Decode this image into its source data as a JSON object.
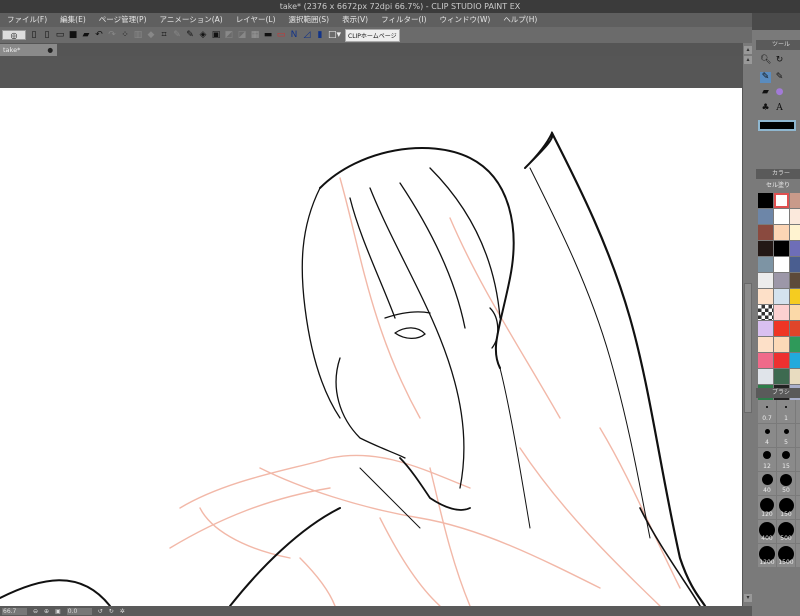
{
  "window": {
    "title": "take* (2376 x 6672px 72dpi 66.7%) - CLIP STUDIO PAINT EX"
  },
  "menu": [
    "ファイル(F)",
    "編集(E)",
    "ページ管理(P)",
    "アニメーション(A)",
    "レイヤー(L)",
    "選択範囲(S)",
    "表示(V)",
    "フィルター(I)",
    "ウィンドウ(W)",
    "ヘルプ(H)"
  ],
  "toolbar": {
    "home_label": "CLIPホームページ"
  },
  "tab": {
    "label": "take*",
    "close": "●"
  },
  "status": {
    "zoom": "66.7",
    "angle": "0.0"
  },
  "panels": {
    "tool_title": "ツール",
    "color_title": "カラー",
    "color_set": "セル塗り",
    "brush_title": "ブラシ"
  },
  "colors": [
    "#000000",
    "#f9e0d6",
    "#c99a8a",
    "#6d86a8",
    "#ffffff",
    "#fbe9dc",
    "#8a4a3f",
    "#fcd5b5",
    "#fff3d0",
    "#231815",
    "#000000",
    "#6e6eb8",
    "#7d94a4",
    "#ffffff",
    "#4a5e90",
    "#ececec",
    "#9c97a8",
    "#5d4a3a",
    "#fde0c8",
    "#d4e2ee",
    "#f5cc20",
    "checker",
    "#fcd0d0",
    "#fbd9a8",
    "#d9c0f0",
    "#ee3524",
    "#e0452a",
    "#fde0c8",
    "#fcd9b8",
    "#2f9a5a",
    "#f06a8a",
    "#ee3030",
    "#22aadd",
    "#e0e4ea",
    "#3d6a50",
    "#e8dcc0",
    "#2e7d4a",
    "#222222",
    "#aab0cc"
  ],
  "brush_sizes": [
    "0.7",
    "1",
    "",
    "4",
    "5",
    "",
    "12",
    "15",
    "",
    "40",
    "50",
    "",
    "120",
    "150",
    "",
    "400",
    "500",
    "",
    "1200",
    "1500",
    ""
  ],
  "accent": "#5a9cc8"
}
